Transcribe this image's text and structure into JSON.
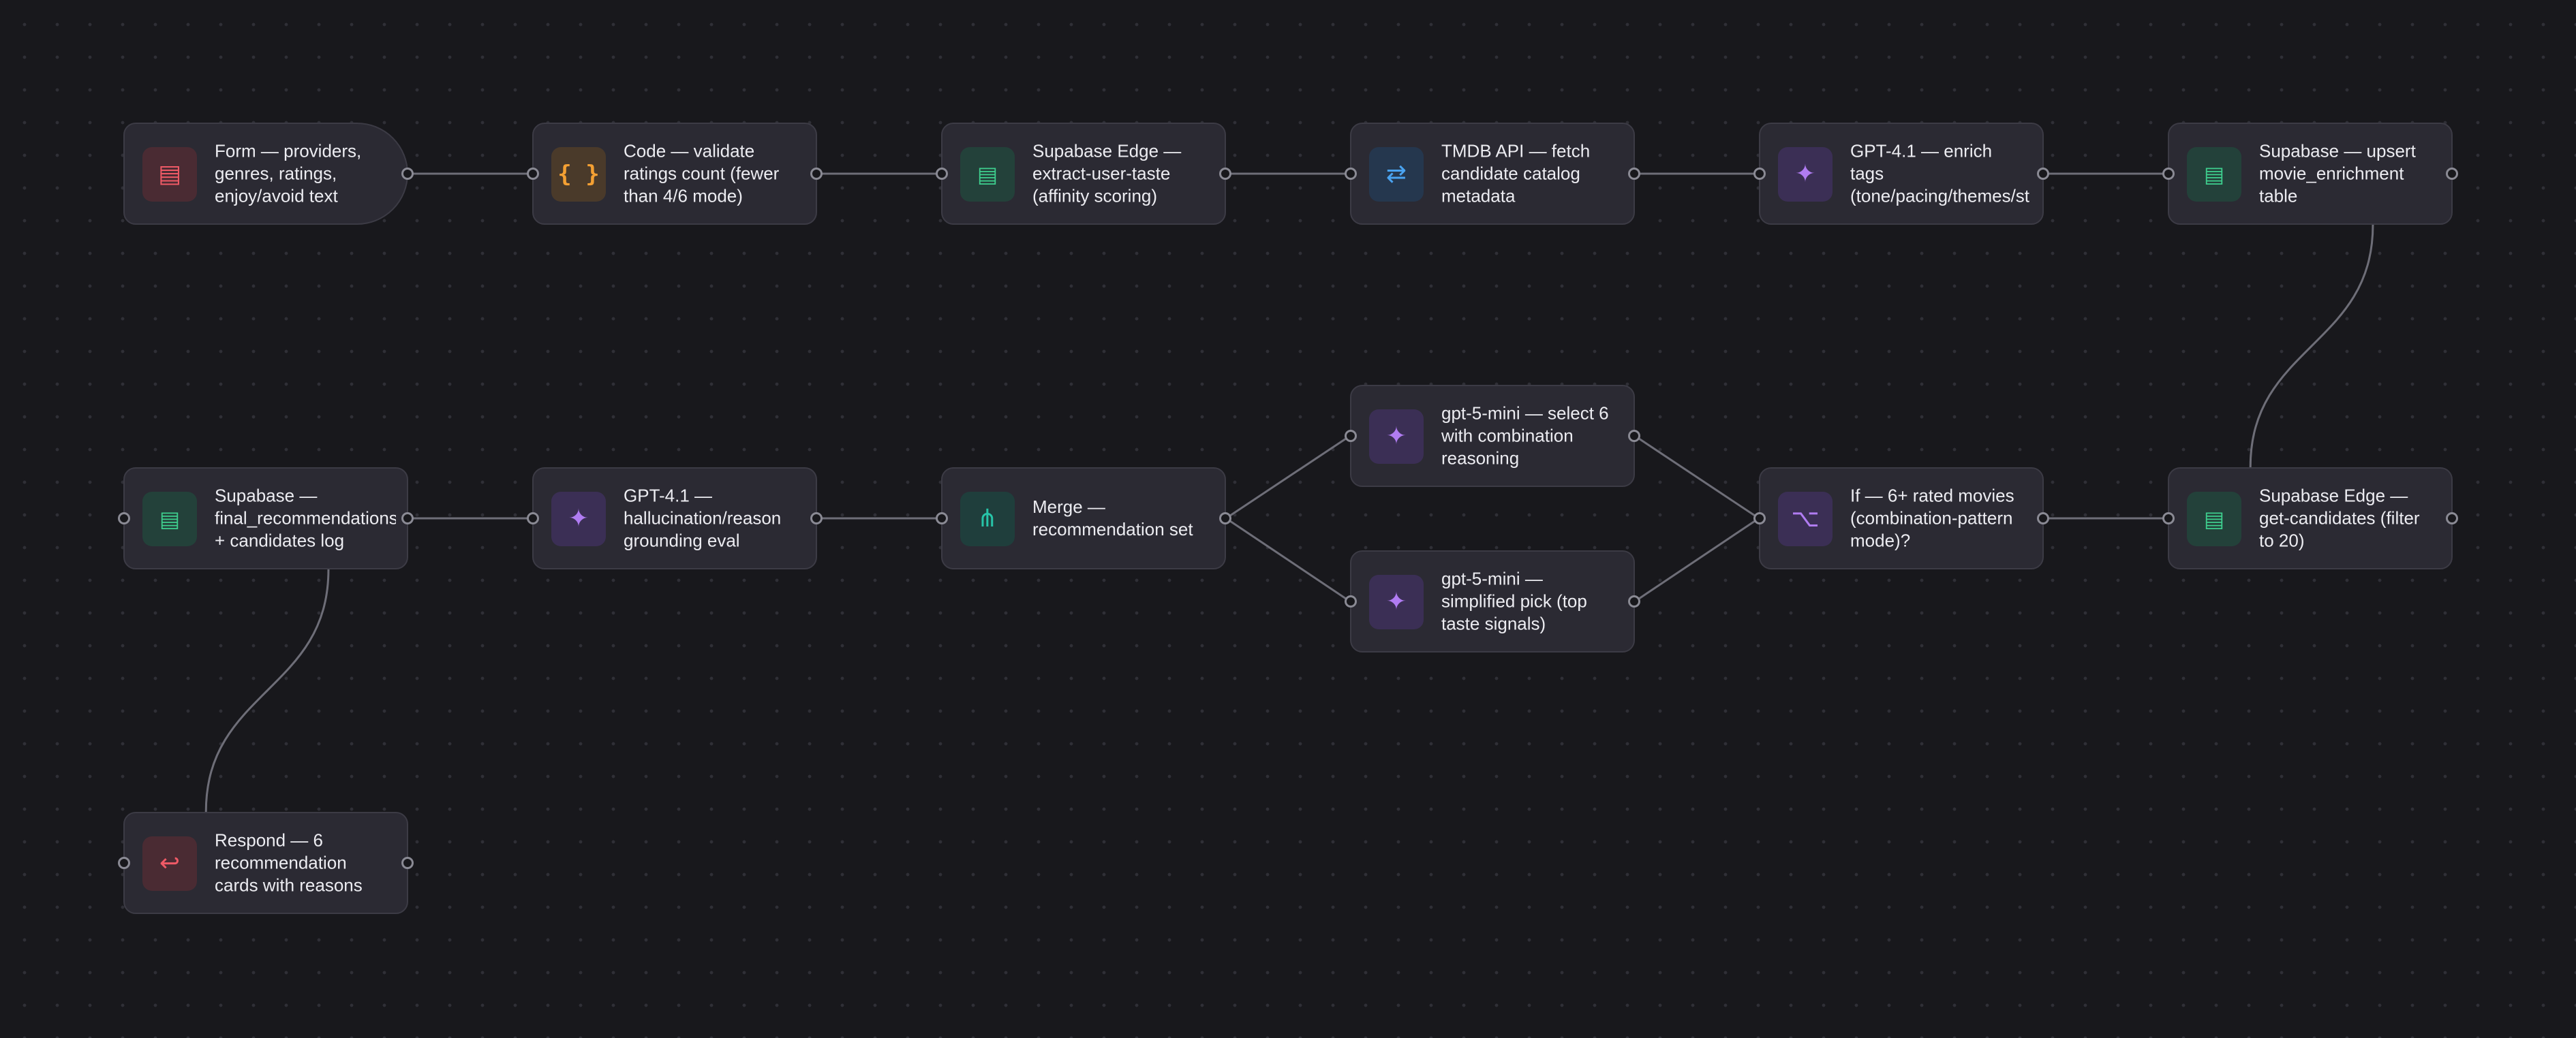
{
  "workflow": {
    "nodes": [
      {
        "id": "form",
        "label": "Form — providers,\ngenres, ratings,\nenjoy/avoid text",
        "icon": "form-icon",
        "color": "#ef5a66",
        "glyph": "▤"
      },
      {
        "id": "code",
        "label": "Code — validate\nratings count (fewer\nthan 4/6 mode)",
        "icon": "code-icon",
        "color": "#f4a033",
        "glyph": "{ }"
      },
      {
        "id": "supabase-edge-taste",
        "label": "Supabase Edge —\nextract-user-taste\n(affinity scoring)",
        "icon": "supabase-icon",
        "color": "#3ecf8e",
        "glyph": "▤"
      },
      {
        "id": "tmdb",
        "label": "TMDB API — fetch\ncandidate catalog\nmetadata",
        "icon": "http-icon",
        "color": "#4aa3f0",
        "glyph": "⇄"
      },
      {
        "id": "gpt-enrich",
        "label": "GPT-4.1 — enrich\ntags\n(tone/pacing/themes/st",
        "icon": "ai-sparkle-icon",
        "color": "#b07cf2",
        "glyph": "✦"
      },
      {
        "id": "supabase-upsert",
        "label": "Supabase — upsert\nmovie_enrichment\ntable",
        "icon": "supabase-icon",
        "color": "#3ecf8e",
        "glyph": "▤"
      },
      {
        "id": "supabase-final",
        "label": "Supabase —\nfinal_recommendations\n+ candidates log",
        "icon": "supabase-icon",
        "color": "#3ecf8e",
        "glyph": "▤"
      },
      {
        "id": "gpt-hallucination",
        "label": "GPT-4.1 —\nhallucination/reason\ngrounding eval",
        "icon": "ai-sparkle-icon",
        "color": "#b07cf2",
        "glyph": "✦"
      },
      {
        "id": "merge",
        "label": "Merge —\nrecommendation set",
        "icon": "merge-icon",
        "color": "#27c4a8",
        "glyph": "⋔"
      },
      {
        "id": "gpt-mini-select",
        "label": "gpt-5-mini — select 6\nwith combination\nreasoning",
        "icon": "ai-sparkle-icon",
        "color": "#b07cf2",
        "glyph": "✦"
      },
      {
        "id": "gpt-mini-simplified",
        "label": "gpt-5-mini —\nsimplified pick (top\ntaste signals)",
        "icon": "ai-sparkle-icon",
        "color": "#b07cf2",
        "glyph": "✦"
      },
      {
        "id": "if-rated",
        "label": "If — 6+ rated movies\n(combination-pattern\nmode)?",
        "icon": "branch-icon",
        "color": "#b07cf2",
        "glyph": "⌥"
      },
      {
        "id": "supabase-edge-candidates",
        "label": "Supabase Edge —\nget-candidates (filter\nto 20)",
        "icon": "supabase-icon",
        "color": "#3ecf8e",
        "glyph": "▤"
      },
      {
        "id": "respond",
        "label": "Respond — 6\nrecommendation\ncards with reasons",
        "icon": "respond-icon",
        "color": "#ef5a66",
        "glyph": "↩"
      }
    ],
    "connections": [
      [
        "form",
        "code"
      ],
      [
        "code",
        "supabase-edge-taste"
      ],
      [
        "supabase-edge-taste",
        "tmdb"
      ],
      [
        "tmdb",
        "gpt-enrich"
      ],
      [
        "gpt-enrich",
        "supabase-upsert"
      ],
      [
        "supabase-upsert",
        "supabase-edge-candidates"
      ],
      [
        "supabase-edge-candidates",
        "if-rated"
      ],
      [
        "if-rated",
        "gpt-mini-select"
      ],
      [
        "if-rated",
        "gpt-mini-simplified"
      ],
      [
        "gpt-mini-select",
        "merge"
      ],
      [
        "gpt-mini-simplified",
        "merge"
      ],
      [
        "merge",
        "gpt-hallucination"
      ],
      [
        "gpt-hallucination",
        "supabase-final"
      ],
      [
        "supabase-final",
        "respond"
      ]
    ],
    "edge_color": "#6e6e78"
  }
}
